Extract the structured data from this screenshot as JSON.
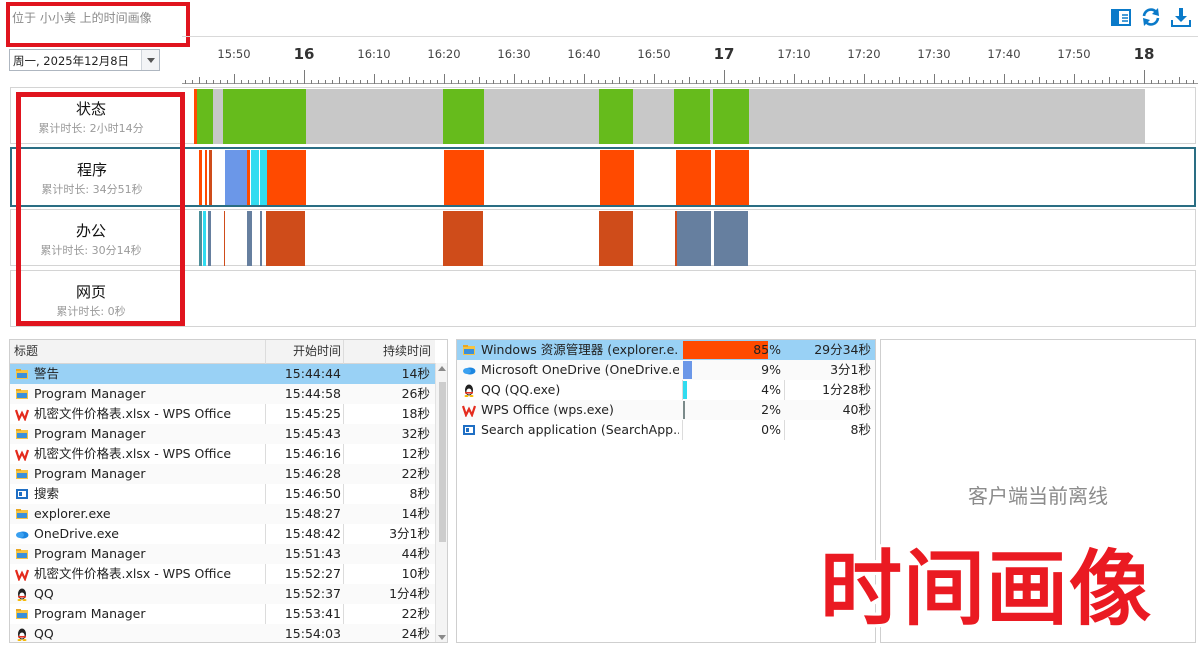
{
  "header": {
    "title": "位于 小小美 上的时间画像",
    "icons": [
      "sidebar-panel-icon",
      "refresh-icon",
      "download-icon"
    ]
  },
  "date_select": {
    "value": "周一, 2025年12月8日"
  },
  "timeline": {
    "labels": [
      "15:50",
      "16",
      "16:10",
      "16:20",
      "16:30",
      "16:40",
      "16:50",
      "17",
      "17:10",
      "17:20",
      "17:30",
      "17:40",
      "17:50",
      "18"
    ]
  },
  "lanes": [
    {
      "name": "状态",
      "sub": "累计时长: 2小时14分"
    },
    {
      "name": "程序",
      "sub": "累计时长: 34分51秒"
    },
    {
      "name": "办公",
      "sub": "累计时长: 30分14秒"
    },
    {
      "name": "网页",
      "sub": "累计时长: 0秒"
    }
  ],
  "colors": {
    "active": "#66bb1c",
    "idle": "#c8c8c8",
    "explorer": "#ff4a00",
    "office": "#cf4c1a",
    "blue_slate": "#667f9f",
    "onedrive": "#6b97e8",
    "qq": "#31dcf0",
    "accent": "#0a7ac9",
    "watermark": "#ea1a22"
  },
  "events_table": {
    "headers": {
      "title": "标题",
      "start": "开始时间",
      "duration": "持续时间"
    },
    "rows": [
      {
        "icon": "folder-icon",
        "title": "警告",
        "start": "15:44:44",
        "duration": "14秒"
      },
      {
        "icon": "folder-icon",
        "title": "Program Manager",
        "start": "15:44:58",
        "duration": "26秒"
      },
      {
        "icon": "wps-icon",
        "title": "机密文件价格表.xlsx - WPS Office",
        "start": "15:45:25",
        "duration": "18秒"
      },
      {
        "icon": "folder-icon",
        "title": "Program Manager",
        "start": "15:45:43",
        "duration": "32秒"
      },
      {
        "icon": "wps-icon",
        "title": "机密文件价格表.xlsx - WPS Office",
        "start": "15:46:16",
        "duration": "12秒"
      },
      {
        "icon": "folder-icon",
        "title": "Program Manager",
        "start": "15:46:28",
        "duration": "22秒"
      },
      {
        "icon": "search-app-icon",
        "title": "搜索",
        "start": "15:46:50",
        "duration": "8秒"
      },
      {
        "icon": "folder-icon",
        "title": "explorer.exe",
        "start": "15:48:27",
        "duration": "14秒"
      },
      {
        "icon": "onedrive-icon",
        "title": "OneDrive.exe",
        "start": "15:48:42",
        "duration": "3分1秒"
      },
      {
        "icon": "folder-icon",
        "title": "Program Manager",
        "start": "15:51:43",
        "duration": "44秒"
      },
      {
        "icon": "wps-icon",
        "title": "机密文件价格表.xlsx - WPS Office",
        "start": "15:52:27",
        "duration": "10秒"
      },
      {
        "icon": "qq-icon",
        "title": "QQ",
        "start": "15:52:37",
        "duration": "1分4秒"
      },
      {
        "icon": "folder-icon",
        "title": "Program Manager",
        "start": "15:53:41",
        "duration": "22秒"
      },
      {
        "icon": "qq-icon",
        "title": "QQ",
        "start": "15:54:03",
        "duration": "24秒"
      }
    ]
  },
  "process_table": {
    "rows": [
      {
        "icon": "folder-icon",
        "name": "Windows 资源管理器 (explorer.e...",
        "percent": "85%",
        "share": 0.85,
        "duration": "29分34秒",
        "color": "#ff4a00"
      },
      {
        "icon": "onedrive-icon",
        "name": "Microsoft OneDrive (OneDrive.e...",
        "percent": "9%",
        "share": 0.09,
        "duration": "3分1秒",
        "color": "#6b97e8"
      },
      {
        "icon": "qq-icon",
        "name": "QQ (QQ.exe)",
        "percent": "4%",
        "share": 0.04,
        "duration": "1分28秒",
        "color": "#31dcf0"
      },
      {
        "icon": "wps-icon",
        "name": "WPS Office (wps.exe)",
        "percent": "2%",
        "share": 0.02,
        "duration": "40秒",
        "color": "#7a8a8a"
      },
      {
        "icon": "search-app-icon",
        "name": "Search application (SearchApp....",
        "percent": "0%",
        "share": 0.0,
        "duration": "8秒",
        "color": "#cccccc"
      }
    ]
  },
  "right_panel": {
    "message": "客户端当前离线"
  },
  "watermark": {
    "text": "时间画像"
  }
}
